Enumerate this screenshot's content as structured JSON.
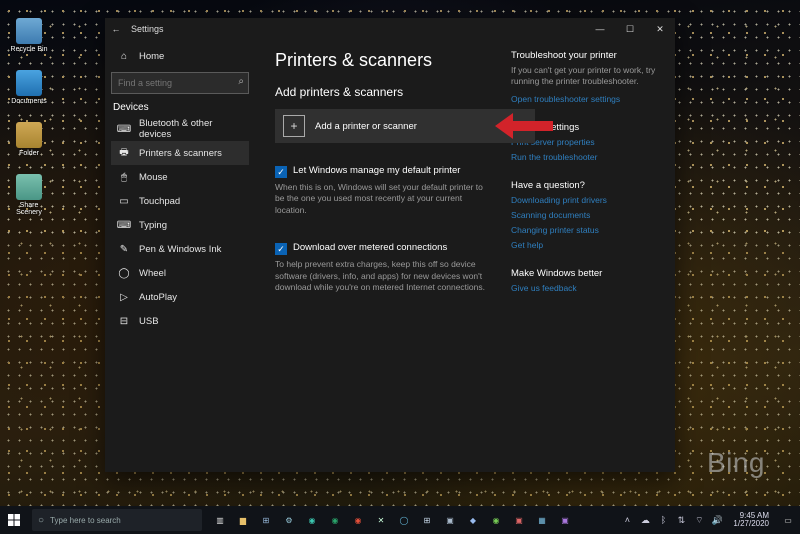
{
  "desktop_icons": [
    {
      "label": "Recycle Bin"
    },
    {
      "label": "Documents"
    },
    {
      "label": "Folder"
    },
    {
      "label": "Share Scenery"
    }
  ],
  "watermark": "Bing",
  "window": {
    "back": "←",
    "title": "Settings",
    "controls": {
      "min": "—",
      "max": "☐",
      "close": "✕"
    }
  },
  "sidebar": {
    "home_icon": "⌂",
    "home_label": "Home",
    "search_placeholder": "Find a setting",
    "category": "Devices",
    "items": [
      {
        "icon": "⌨",
        "label": "Bluetooth & other devices"
      },
      {
        "icon": "🖶",
        "label": "Printers & scanners"
      },
      {
        "icon": "🖱",
        "label": "Mouse"
      },
      {
        "icon": "▭",
        "label": "Touchpad"
      },
      {
        "icon": "⌨",
        "label": "Typing"
      },
      {
        "icon": "✎",
        "label": "Pen & Windows Ink"
      },
      {
        "icon": "◯",
        "label": "Wheel"
      },
      {
        "icon": "▷",
        "label": "AutoPlay"
      },
      {
        "icon": "⊟",
        "label": "USB"
      }
    ]
  },
  "main": {
    "title": "Printers & scanners",
    "section1_heading": "Add printers & scanners",
    "add_button": "Add a printer or scanner",
    "chk1_label": "Let Windows manage my default printer",
    "chk1_desc": "When this is on, Windows will set your default printer to be the one you used most recently at your current location.",
    "chk2_label": "Download over metered connections",
    "chk2_desc": "To help prevent extra charges, keep this off so device software (drivers, info, and apps) for new devices won't download while you're on metered Internet connections."
  },
  "right": {
    "s1_head": "Troubleshoot your printer",
    "s1_text": "If you can't get your printer to work, try running the printer troubleshooter.",
    "s1_link": "Open troubleshooter settings",
    "s2_head": "Related settings",
    "s2_link1": "Print server properties",
    "s2_link2": "Run the troubleshooter",
    "s3_head": "Have a question?",
    "s3_link1": "Downloading print drivers",
    "s3_link2": "Scanning documents",
    "s3_link3": "Changing printer status",
    "s3_link4": "Get help",
    "s4_head": "Make Windows better",
    "s4_link": "Give us feedback"
  },
  "taskbar": {
    "search_placeholder": "Type here to search",
    "time": "9:45 AM",
    "date": "1/27/2020"
  }
}
